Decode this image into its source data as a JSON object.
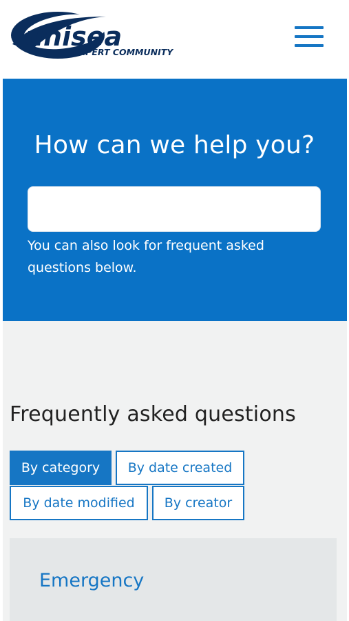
{
  "brand": {
    "logo_wordmark": "unisea",
    "tagline": "EXPERT COMMUNITY",
    "color": "#0a2d5c"
  },
  "header": {
    "menu_icon": "hamburger-menu-icon"
  },
  "hero": {
    "title": "How can we help you?",
    "search_value": "",
    "search_placeholder": "",
    "note": "You can also look for frequent asked questions below.",
    "background": "#0a72c6"
  },
  "faq": {
    "title": "Frequently asked questions",
    "tabs": [
      {
        "label": "By category",
        "active": true
      },
      {
        "label": "By date created",
        "active": false
      },
      {
        "label": "By date modified",
        "active": false
      },
      {
        "label": "By creator",
        "active": false
      }
    ],
    "categories": [
      {
        "label": "Emergency"
      }
    ],
    "accent": "#1676c4"
  }
}
